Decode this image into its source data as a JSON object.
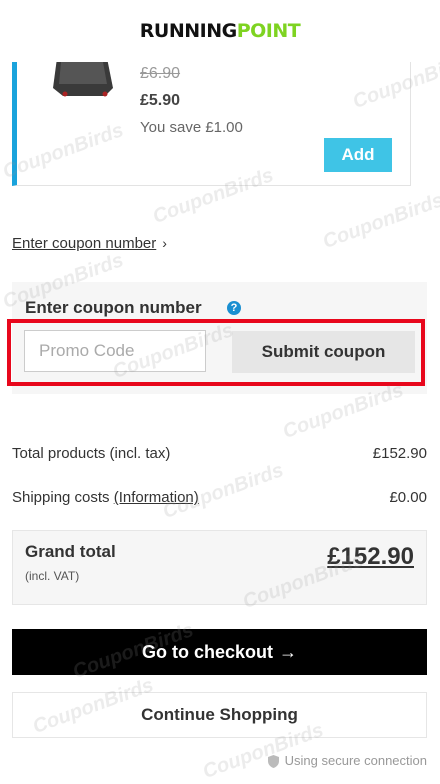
{
  "header": {
    "logo_part1": "RUNNING",
    "logo_part2": "POINT"
  },
  "product": {
    "old_price": "£6.90",
    "new_price": "£5.90",
    "savings": "You save £1.00",
    "add_label": "Add"
  },
  "coupon": {
    "link_text": "Enter coupon number",
    "link_chevron": "›",
    "title": "Enter coupon number",
    "help_icon": "?",
    "input_placeholder": "Promo Code",
    "input_value": "",
    "submit_label": "Submit coupon"
  },
  "summary": {
    "total_label": "Total products (incl. tax)",
    "total_value": "£152.90",
    "shipping_label": "Shipping costs",
    "shipping_link": "(Information)",
    "shipping_value": "£0.00",
    "grand_label": "Grand total",
    "grand_sublabel": "(incl. VAT)",
    "grand_value": "£152.90"
  },
  "actions": {
    "checkout_label": "Go to checkout",
    "checkout_arrow": "→",
    "continue_label": "Continue Shopping"
  },
  "footer": {
    "secure_text": "Using secure connection"
  },
  "watermark": {
    "text": "CouponBirds"
  },
  "colors": {
    "accent_blue": "#1aa3dc",
    "add_button": "#3fc4e6",
    "highlight_red": "#e8071c",
    "logo_green": "#7ed321",
    "checkout_bg": "#000000"
  }
}
